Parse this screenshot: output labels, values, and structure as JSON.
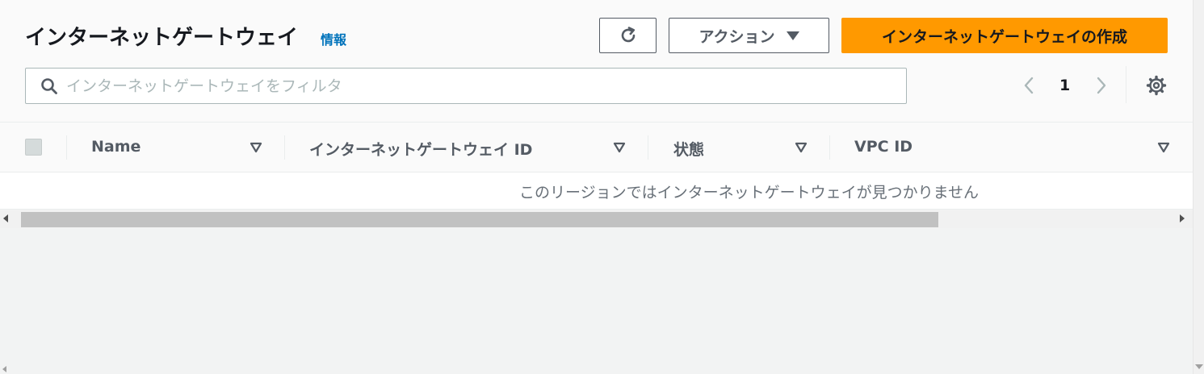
{
  "header": {
    "title": "インターネットゲートウェイ",
    "info_link": "情報",
    "refresh_icon": "refresh-icon",
    "actions_label": "アクション",
    "create_label": "インターネットゲートウェイの作成"
  },
  "search": {
    "placeholder": "インターネットゲートウェイをフィルタ",
    "value": ""
  },
  "pagination": {
    "current_page": "1"
  },
  "table": {
    "columns": [
      {
        "label": "Name"
      },
      {
        "label": "インターネットゲートウェイ ID"
      },
      {
        "label": "状態"
      },
      {
        "label": "VPC ID"
      }
    ],
    "empty_message": "このリージョンではインターネットゲートウェイが見つかりません"
  },
  "colors": {
    "primary": "#ff9900",
    "link": "#0073bb",
    "text": "#16191f",
    "muted": "#687078"
  }
}
